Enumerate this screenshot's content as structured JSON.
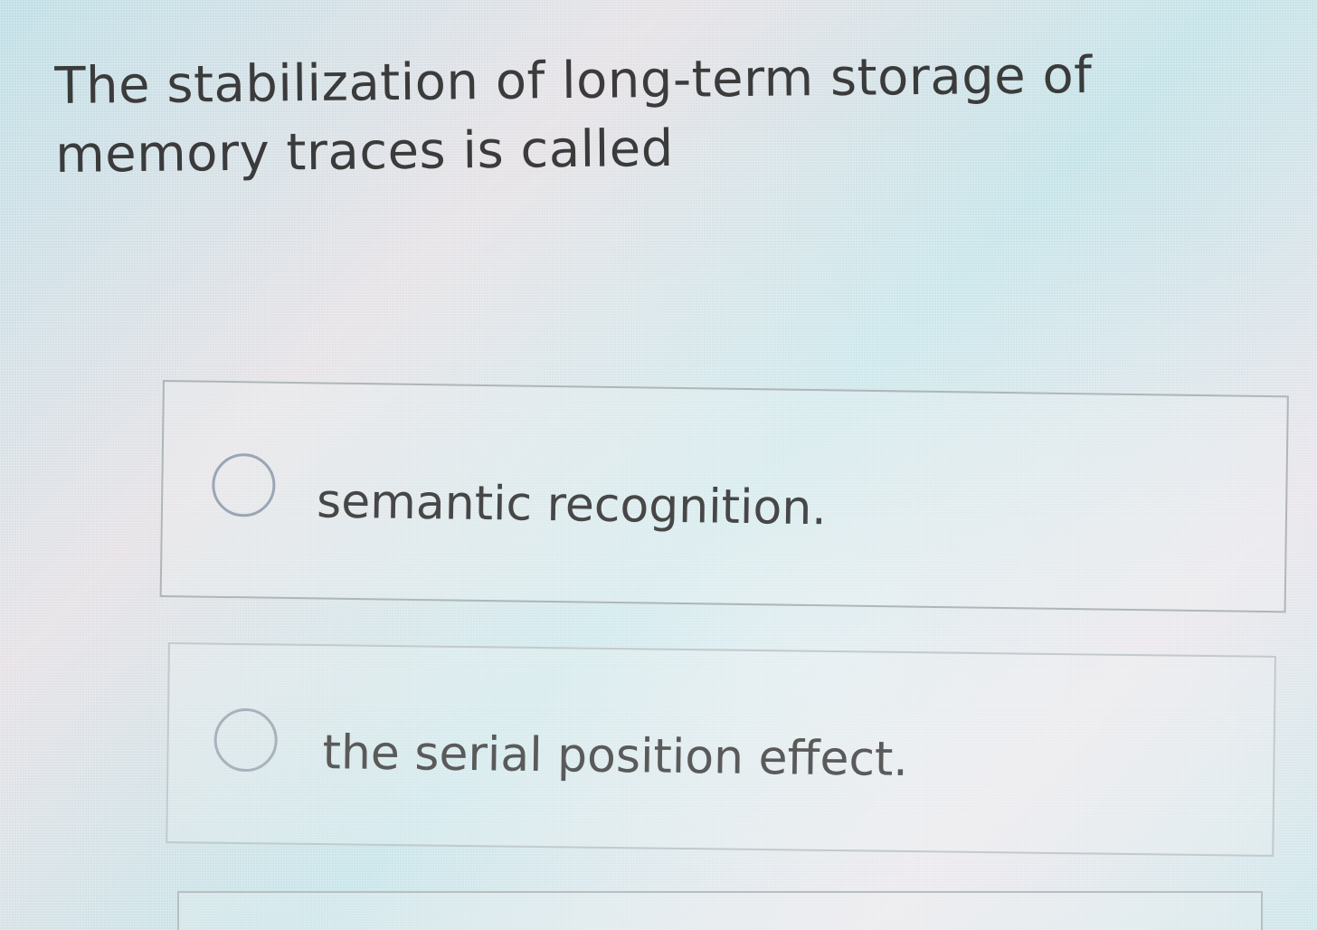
{
  "quiz": {
    "question": "The stabilization of long-term storage of memory traces is called",
    "options": [
      {
        "label": "semantic recognition."
      },
      {
        "label": "the serial position effect."
      }
    ]
  },
  "icons": {
    "radio": "radio-unselected-icon"
  },
  "colors": {
    "text": "#3b3b3b",
    "option_border": "#aeb6b8",
    "radio_border": "#9aa6b4"
  }
}
